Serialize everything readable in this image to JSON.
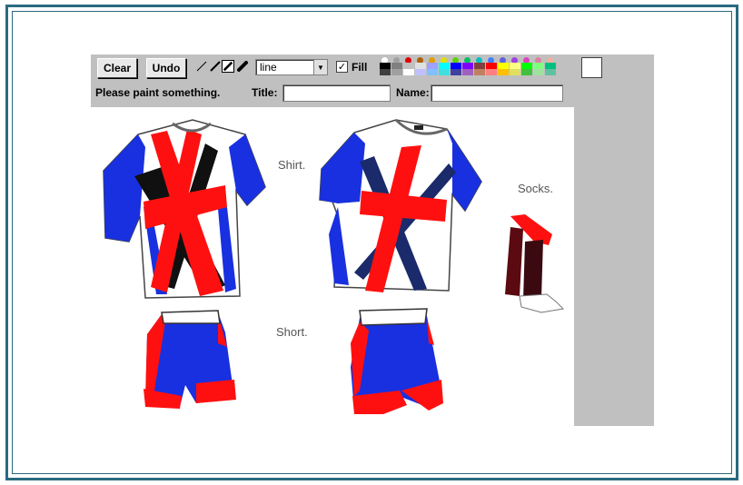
{
  "toolbar": {
    "clear_label": "Clear",
    "undo_label": "Undo",
    "shape_value": "line",
    "fill_label": "Fill",
    "fill_checked": true,
    "tools": [
      "thin-line-tool-icon",
      "thick-line-tool-icon",
      "pen-tool-icon",
      "brush-tool-icon"
    ]
  },
  "status": {
    "message": "Please paint something.",
    "title_label": "Title:",
    "name_label": "Name:",
    "title_value": "",
    "name_value": ""
  },
  "palette": {
    "pins": [
      "#ffffff",
      "#a0a0a0",
      "#e00000",
      "#b06000",
      "#e0a000",
      "#e0e000",
      "#60d000",
      "#00c060",
      "#00c0c0",
      "#4080ff",
      "#6060e0",
      "#a040e0",
      "#e040c0",
      "#e080a0",
      "#f0b0a0"
    ],
    "row1": [
      "#000000",
      "#808080",
      "#c0c0c0",
      "#e0e0e0",
      "#a0a0ff",
      "#00ffff",
      "#0000ff",
      "#8000ff",
      "#804040",
      "#ff0000",
      "#ffff00",
      "#ffff80",
      "#00ff00",
      "#80ff80",
      "#00c080"
    ],
    "row2": [
      "#404040",
      "#a0a0a0",
      "#ffffff",
      "#c0c0ff",
      "#80c0ff",
      "#40e0e0",
      "#4040a0",
      "#a060c0",
      "#c08060",
      "#ff8080",
      "#ffc000",
      "#e0e060",
      "#40c040",
      "#a0e0a0",
      "#60c0a0"
    ],
    "current_color": "#ffffff"
  },
  "canvas": {
    "captions": {
      "shirt": "Shirt.",
      "socks": "Socks.",
      "short": "Short."
    },
    "colors": {
      "blue": "#1830e0",
      "red": "#ff1010",
      "black": "#101010",
      "sock": "#5a0a10"
    }
  }
}
